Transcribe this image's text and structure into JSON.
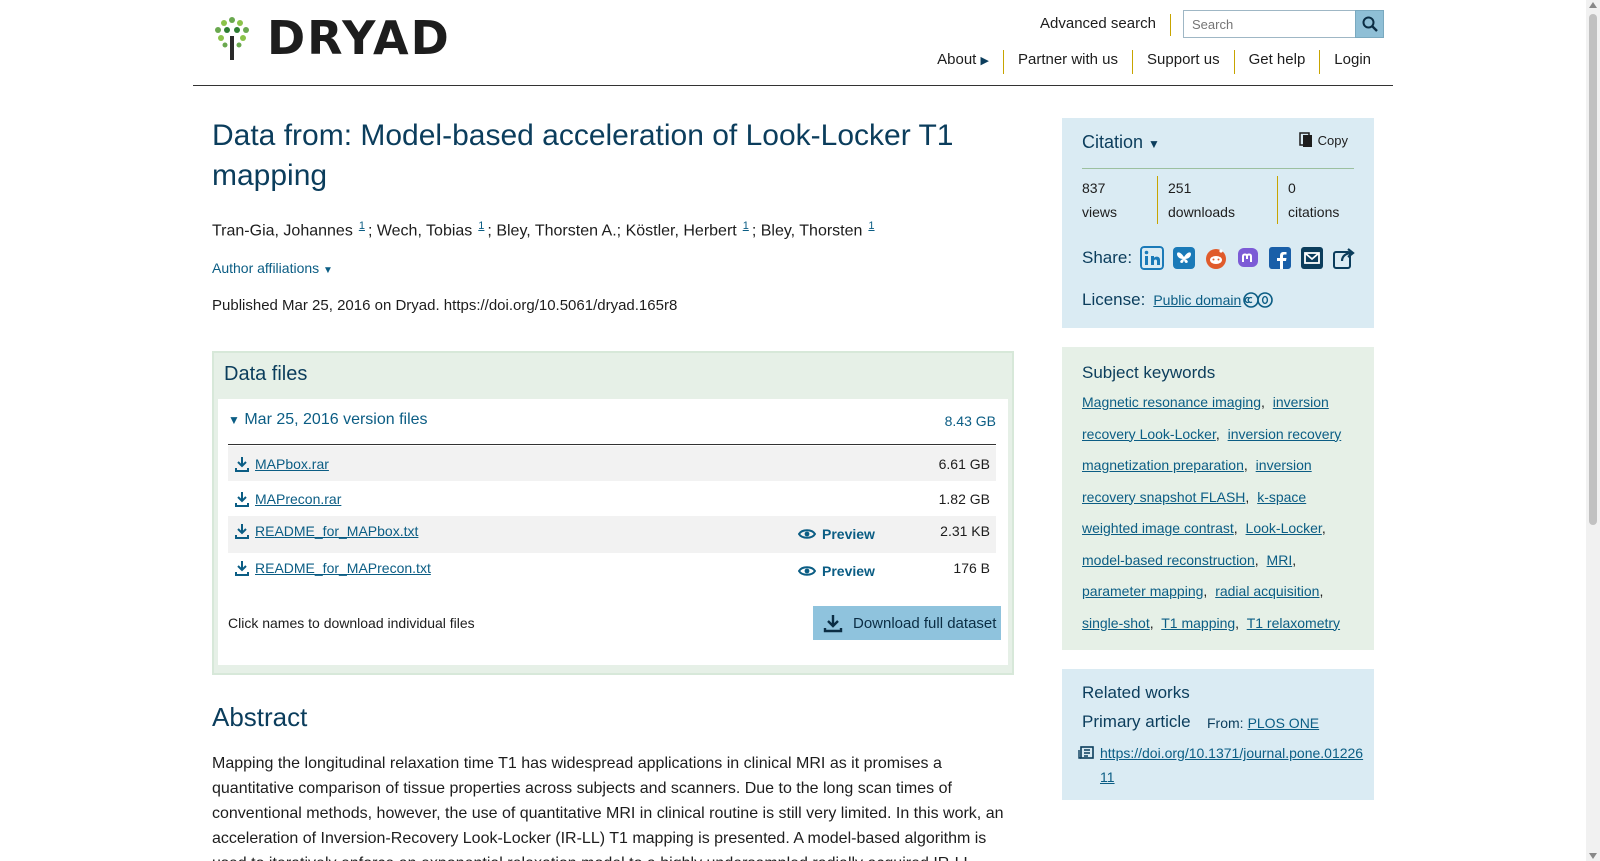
{
  "header": {
    "logo_text": "DRYAD",
    "advanced_search": "Advanced search",
    "search_placeholder": "Search",
    "nav": [
      "About",
      "Partner with us",
      "Support us",
      "Get help",
      "Login"
    ]
  },
  "dataset": {
    "title": "Data from: Model-based acceleration of Look-Locker T1 mapping",
    "authors": [
      {
        "name": "Tran-Gia, Johannes",
        "sup": "1"
      },
      {
        "name": "Wech, Tobias",
        "sup": "1"
      },
      {
        "name": "Bley, Thorsten A.",
        "sup": ""
      },
      {
        "name": "Köstler, Herbert",
        "sup": "1"
      },
      {
        "name": "Bley, Thorsten",
        "sup": "1"
      }
    ],
    "author_affiliations": "Author affiliations",
    "published": "Published Mar 25, 2016 on Dryad. https://doi.org/10.5061/dryad.165r8"
  },
  "data_files": {
    "heading": "Data files",
    "version_label": "Mar 25, 2016 version files",
    "version_size": "8.43 GB",
    "files": [
      {
        "name": "MAPbox.rar",
        "size": "6.61 GB",
        "preview": ""
      },
      {
        "name": "MAPrecon.rar",
        "size": "1.82 GB",
        "preview": ""
      },
      {
        "name": "README_for_MAPbox.txt",
        "size": "2.31 KB",
        "preview": "Preview"
      },
      {
        "name": "README_for_MAPrecon.txt",
        "size": "176 B",
        "preview": "Preview"
      }
    ],
    "note": "Click names to download individual files",
    "download_full": "Download full dataset"
  },
  "abstract": {
    "heading": "Abstract",
    "text": "Mapping the longitudinal relaxation time T1 has widespread applications in clinical MRI as it promises a quantitative comparison of tissue properties across subjects and scanners. Due to the long scan times of conventional methods, however, the use of quantitative MRI in clinical routine is still very limited. In this work, an acceleration of Inversion-Recovery Look-Locker (IR-LL) T1 mapping is presented. A model-based algorithm is used to iteratively enforce an exponential relaxation model to a highly undersampled radially acquired IR-LL"
  },
  "citation": {
    "heading": "Citation",
    "copy": "Copy",
    "stats": [
      {
        "value": "837",
        "label": "views"
      },
      {
        "value": "251",
        "label": "downloads"
      },
      {
        "value": "0",
        "label": "citations"
      }
    ],
    "share_label": "Share:",
    "license_label": "License:",
    "license_value": "Public domain"
  },
  "keywords": {
    "heading": "Subject keywords",
    "items": [
      "Magnetic resonance imaging",
      "inversion recovery Look-Locker",
      "inversion recovery magnetization preparation",
      "inversion recovery snapshot FLASH",
      "k-space weighted image contrast",
      "Look-Locker",
      "model-based reconstruction",
      "MRI",
      "parameter mapping",
      "radial acquisition",
      "single-shot",
      "T1 mapping",
      "T1 relaxometry"
    ]
  },
  "related": {
    "heading": "Related works",
    "primary": "Primary article",
    "from_label": "From:",
    "from_value": "PLOS ONE",
    "doi": "https://doi.org/10.1371/journal.pone.0122611"
  },
  "colors": {
    "accent": "#0b5d84",
    "citation_bg": "#daebf3",
    "keywords_bg": "#e6f0e7",
    "button_bg": "#8fc3dd"
  }
}
